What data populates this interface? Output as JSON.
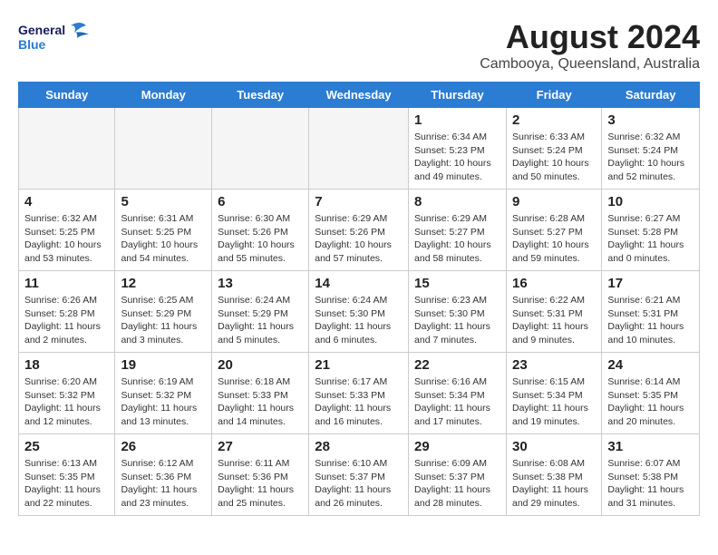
{
  "header": {
    "logo_line1": "General",
    "logo_line2": "Blue",
    "month": "August 2024",
    "location": "Cambooya, Queensland, Australia"
  },
  "days_of_week": [
    "Sunday",
    "Monday",
    "Tuesday",
    "Wednesday",
    "Thursday",
    "Friday",
    "Saturday"
  ],
  "weeks": [
    [
      {
        "day": "",
        "text": "",
        "empty": true
      },
      {
        "day": "",
        "text": "",
        "empty": true
      },
      {
        "day": "",
        "text": "",
        "empty": true
      },
      {
        "day": "",
        "text": "",
        "empty": true
      },
      {
        "day": "1",
        "text": "Sunrise: 6:34 AM\nSunset: 5:23 PM\nDaylight: 10 hours and 49 minutes."
      },
      {
        "day": "2",
        "text": "Sunrise: 6:33 AM\nSunset: 5:24 PM\nDaylight: 10 hours and 50 minutes."
      },
      {
        "day": "3",
        "text": "Sunrise: 6:32 AM\nSunset: 5:24 PM\nDaylight: 10 hours and 52 minutes."
      }
    ],
    [
      {
        "day": "4",
        "text": "Sunrise: 6:32 AM\nSunset: 5:25 PM\nDaylight: 10 hours and 53 minutes."
      },
      {
        "day": "5",
        "text": "Sunrise: 6:31 AM\nSunset: 5:25 PM\nDaylight: 10 hours and 54 minutes."
      },
      {
        "day": "6",
        "text": "Sunrise: 6:30 AM\nSunset: 5:26 PM\nDaylight: 10 hours and 55 minutes."
      },
      {
        "day": "7",
        "text": "Sunrise: 6:29 AM\nSunset: 5:26 PM\nDaylight: 10 hours and 57 minutes."
      },
      {
        "day": "8",
        "text": "Sunrise: 6:29 AM\nSunset: 5:27 PM\nDaylight: 10 hours and 58 minutes."
      },
      {
        "day": "9",
        "text": "Sunrise: 6:28 AM\nSunset: 5:27 PM\nDaylight: 10 hours and 59 minutes."
      },
      {
        "day": "10",
        "text": "Sunrise: 6:27 AM\nSunset: 5:28 PM\nDaylight: 11 hours and 0 minutes."
      }
    ],
    [
      {
        "day": "11",
        "text": "Sunrise: 6:26 AM\nSunset: 5:28 PM\nDaylight: 11 hours and 2 minutes."
      },
      {
        "day": "12",
        "text": "Sunrise: 6:25 AM\nSunset: 5:29 PM\nDaylight: 11 hours and 3 minutes."
      },
      {
        "day": "13",
        "text": "Sunrise: 6:24 AM\nSunset: 5:29 PM\nDaylight: 11 hours and 5 minutes."
      },
      {
        "day": "14",
        "text": "Sunrise: 6:24 AM\nSunset: 5:30 PM\nDaylight: 11 hours and 6 minutes."
      },
      {
        "day": "15",
        "text": "Sunrise: 6:23 AM\nSunset: 5:30 PM\nDaylight: 11 hours and 7 minutes."
      },
      {
        "day": "16",
        "text": "Sunrise: 6:22 AM\nSunset: 5:31 PM\nDaylight: 11 hours and 9 minutes."
      },
      {
        "day": "17",
        "text": "Sunrise: 6:21 AM\nSunset: 5:31 PM\nDaylight: 11 hours and 10 minutes."
      }
    ],
    [
      {
        "day": "18",
        "text": "Sunrise: 6:20 AM\nSunset: 5:32 PM\nDaylight: 11 hours and 12 minutes."
      },
      {
        "day": "19",
        "text": "Sunrise: 6:19 AM\nSunset: 5:32 PM\nDaylight: 11 hours and 13 minutes."
      },
      {
        "day": "20",
        "text": "Sunrise: 6:18 AM\nSunset: 5:33 PM\nDaylight: 11 hours and 14 minutes."
      },
      {
        "day": "21",
        "text": "Sunrise: 6:17 AM\nSunset: 5:33 PM\nDaylight: 11 hours and 16 minutes."
      },
      {
        "day": "22",
        "text": "Sunrise: 6:16 AM\nSunset: 5:34 PM\nDaylight: 11 hours and 17 minutes."
      },
      {
        "day": "23",
        "text": "Sunrise: 6:15 AM\nSunset: 5:34 PM\nDaylight: 11 hours and 19 minutes."
      },
      {
        "day": "24",
        "text": "Sunrise: 6:14 AM\nSunset: 5:35 PM\nDaylight: 11 hours and 20 minutes."
      }
    ],
    [
      {
        "day": "25",
        "text": "Sunrise: 6:13 AM\nSunset: 5:35 PM\nDaylight: 11 hours and 22 minutes."
      },
      {
        "day": "26",
        "text": "Sunrise: 6:12 AM\nSunset: 5:36 PM\nDaylight: 11 hours and 23 minutes."
      },
      {
        "day": "27",
        "text": "Sunrise: 6:11 AM\nSunset: 5:36 PM\nDaylight: 11 hours and 25 minutes."
      },
      {
        "day": "28",
        "text": "Sunrise: 6:10 AM\nSunset: 5:37 PM\nDaylight: 11 hours and 26 minutes."
      },
      {
        "day": "29",
        "text": "Sunrise: 6:09 AM\nSunset: 5:37 PM\nDaylight: 11 hours and 28 minutes."
      },
      {
        "day": "30",
        "text": "Sunrise: 6:08 AM\nSunset: 5:38 PM\nDaylight: 11 hours and 29 minutes."
      },
      {
        "day": "31",
        "text": "Sunrise: 6:07 AM\nSunset: 5:38 PM\nDaylight: 11 hours and 31 minutes."
      }
    ]
  ]
}
